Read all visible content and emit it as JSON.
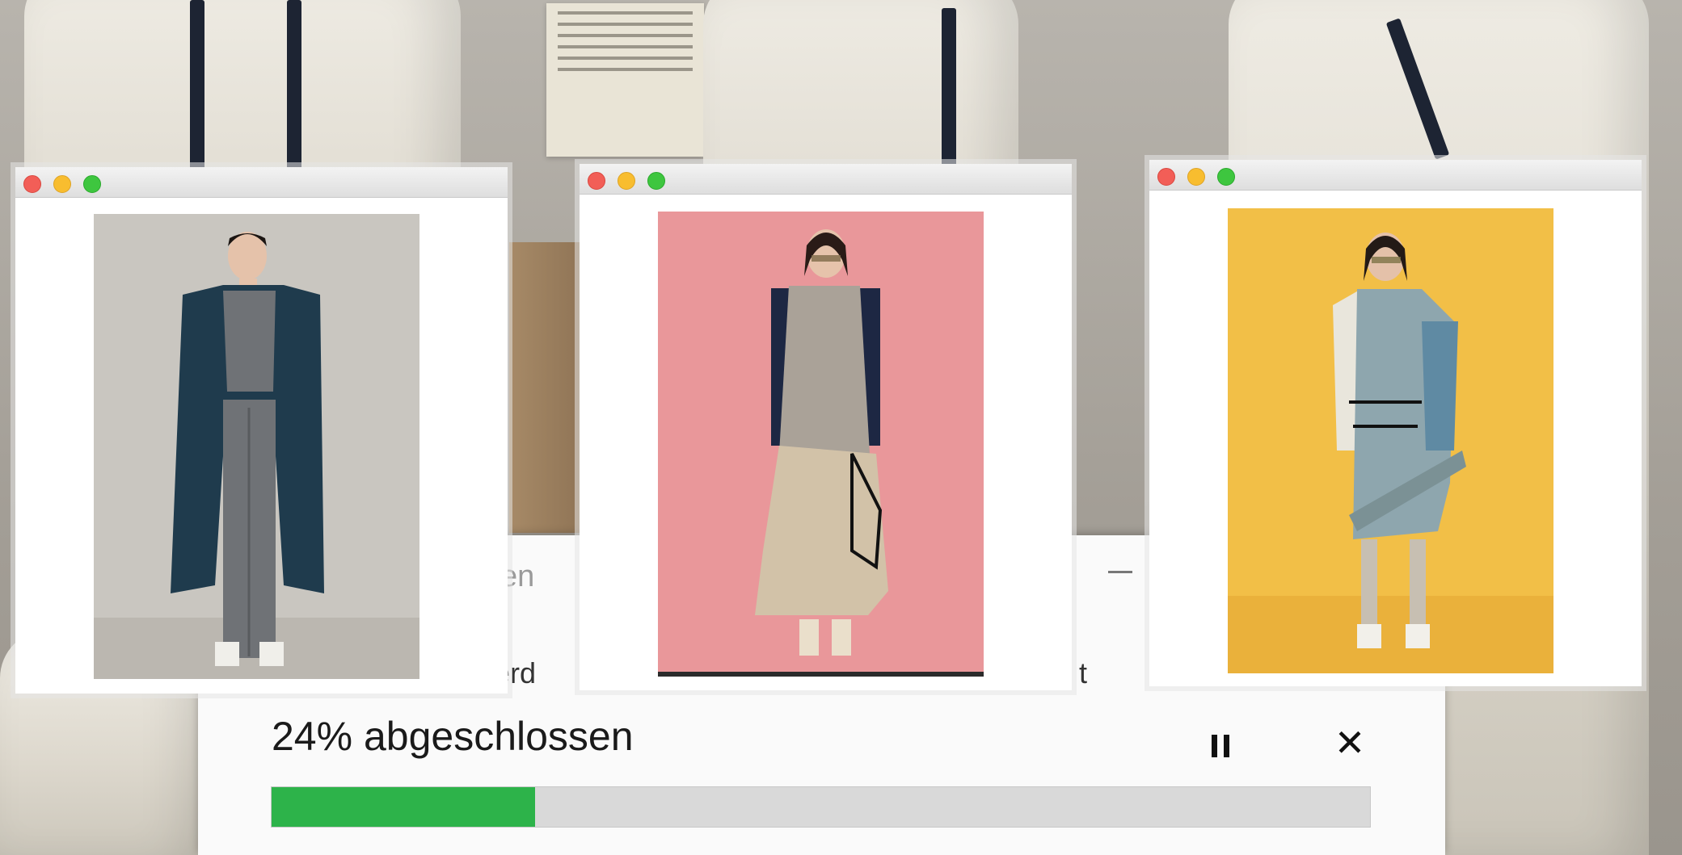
{
  "download_dialog": {
    "title_fragment": "sen",
    "message_left_fragment": "werd",
    "message_right_fragment": "t",
    "status_text": "24% abgeschlossen",
    "progress_fraction": 0.24,
    "progress_color": "#2db34a",
    "pause_icon": "pause-icon",
    "close_icon": "close-icon",
    "close_glyph": "✕"
  },
  "preview_windows": [
    {
      "window_controls": [
        "close",
        "minimize",
        "zoom"
      ],
      "photo_backdrop": "#c9c6c0",
      "look_colors": [
        "#1f3b4d",
        "#6f7276"
      ]
    },
    {
      "window_controls": [
        "close",
        "minimize",
        "zoom"
      ],
      "photo_backdrop": "#e9979a",
      "look_colors": [
        "#d2c2a8",
        "#1d2743"
      ]
    },
    {
      "window_controls": [
        "close",
        "minimize",
        "zoom"
      ],
      "photo_backdrop": "#f2bf47",
      "look_colors": [
        "#8ea6ae",
        "#e9e6dc"
      ]
    }
  ]
}
